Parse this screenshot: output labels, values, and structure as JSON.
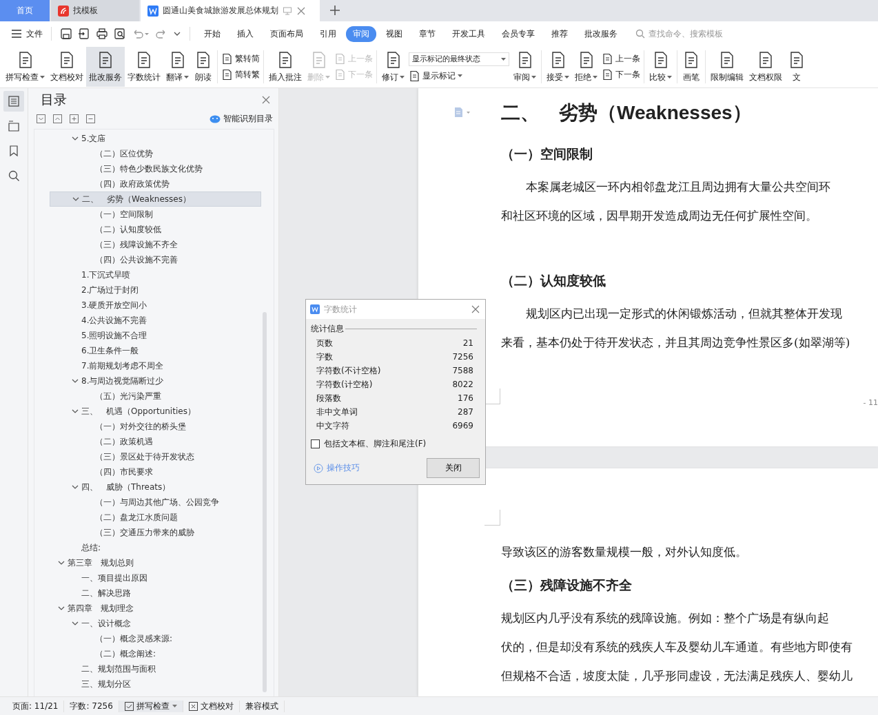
{
  "tabs": [
    {
      "kind": "home",
      "label": "首页",
      "selected": false
    },
    {
      "kind": "template",
      "label": "找模板",
      "selected": false
    },
    {
      "kind": "document",
      "label": "圆通山美食城旅游发展总体规划",
      "selected": true
    }
  ],
  "menu": {
    "file": "文件",
    "tabs": [
      {
        "label": "开始",
        "selected": false
      },
      {
        "label": "插入",
        "selected": false
      },
      {
        "label": "页面布局",
        "selected": false
      },
      {
        "label": "引用",
        "selected": false
      },
      {
        "label": "审阅",
        "selected": true
      },
      {
        "label": "视图",
        "selected": false
      },
      {
        "label": "章节",
        "selected": false
      },
      {
        "label": "开发工具",
        "selected": false
      },
      {
        "label": "会员专享",
        "selected": false
      },
      {
        "label": "推荐",
        "selected": false
      },
      {
        "label": "批改服务",
        "selected": false
      }
    ],
    "search": {
      "placeholder": "查找命令、搜索模板"
    }
  },
  "ribbon": [
    {
      "kind": "big",
      "label": "拼写检查",
      "dropdown": true,
      "disabled": false,
      "pressed": false
    },
    {
      "kind": "big",
      "label": "文档校对",
      "dropdown": false,
      "disabled": false,
      "pressed": false
    },
    {
      "kind": "big",
      "label": "批改服务",
      "dropdown": false,
      "disabled": false,
      "pressed": true
    },
    {
      "kind": "big",
      "label": "字数统计",
      "dropdown": false,
      "disabled": false,
      "pressed": false
    },
    {
      "kind": "big",
      "label": "翻译",
      "dropdown": true,
      "disabled": false,
      "pressed": false
    },
    {
      "kind": "big",
      "label": "朗读",
      "dropdown": false,
      "disabled": false,
      "pressed": false
    },
    {
      "kind": "separator"
    },
    {
      "kind": "stack",
      "items": [
        {
          "kind": "small",
          "label": "繁转简",
          "dropdown": false,
          "disabled": false
        },
        {
          "kind": "small",
          "label": "简转繁",
          "dropdown": false,
          "disabled": false
        }
      ]
    },
    {
      "kind": "separator"
    },
    {
      "kind": "big",
      "label": "插入批注",
      "dropdown": false,
      "disabled": false,
      "pressed": false
    },
    {
      "kind": "big",
      "label": "删除",
      "dropdown": true,
      "disabled": true,
      "pressed": false
    },
    {
      "kind": "stack",
      "items": [
        {
          "kind": "small",
          "label": "上一条",
          "dropdown": false,
          "disabled": true
        },
        {
          "kind": "small",
          "label": "下一条",
          "dropdown": false,
          "disabled": true
        }
      ]
    },
    {
      "kind": "separator"
    },
    {
      "kind": "big",
      "label": "修订",
      "dropdown": true,
      "disabled": false,
      "pressed": false
    },
    {
      "kind": "stack",
      "items": [
        {
          "kind": "select",
          "value": "显示标记的最终状态"
        },
        {
          "kind": "small",
          "label": "显示标记",
          "dropdown": true,
          "disabled": false
        }
      ]
    },
    {
      "kind": "big",
      "label": "审阅",
      "dropdown": true,
      "disabled": false,
      "pressed": false
    },
    {
      "kind": "separator"
    },
    {
      "kind": "big",
      "label": "接受",
      "dropdown": true,
      "disabled": false,
      "pressed": false
    },
    {
      "kind": "big",
      "label": "拒绝",
      "dropdown": true,
      "disabled": false,
      "pressed": false
    },
    {
      "kind": "stack",
      "items": [
        {
          "kind": "small",
          "label": "上一条",
          "dropdown": false,
          "disabled": false
        },
        {
          "kind": "small",
          "label": "下一条",
          "dropdown": false,
          "disabled": false
        }
      ]
    },
    {
      "kind": "separator"
    },
    {
      "kind": "big",
      "label": "比较",
      "dropdown": true,
      "disabled": false,
      "pressed": false
    },
    {
      "kind": "separator"
    },
    {
      "kind": "big",
      "label": "画笔",
      "dropdown": false,
      "disabled": false,
      "pressed": false
    },
    {
      "kind": "separator"
    },
    {
      "kind": "big",
      "label": "限制编辑",
      "dropdown": false,
      "disabled": false,
      "pressed": false
    },
    {
      "kind": "big",
      "label": "文档权限",
      "dropdown": false,
      "disabled": false,
      "pressed": false
    },
    {
      "kind": "big",
      "label": "文",
      "dropdown": false,
      "disabled": false,
      "pressed": false
    }
  ],
  "side_strip": [
    {
      "selected": true
    },
    {
      "selected": false
    },
    {
      "selected": false
    },
    {
      "selected": false
    }
  ],
  "toc": {
    "title": "目录",
    "smart_button": "智能识别目录",
    "leading_items": [
      {
        "label": "5.文庙",
        "expanded": true,
        "selected": false,
        "children": [
          {
            "label": "（二）区位优势",
            "selected": false
          },
          {
            "label": "（三）特色少数民族文化优势",
            "selected": false
          },
          {
            "label": "（四）政府政策优势",
            "selected": false
          }
        ]
      },
      {
        "label": "二、　劣势（Weaknesses）",
        "expanded": true,
        "selected": true,
        "children": [
          {
            "label": "（一）空间限制",
            "selected": false
          },
          {
            "label": "（二）认知度较低",
            "selected": false
          },
          {
            "label": "（三）残障设施不齐全",
            "selected": false
          },
          {
            "label": "（四）公共设施不完善",
            "selected": false
          }
        ]
      },
      {
        "label": "1.下沉式旱喷",
        "selected": false
      },
      {
        "label": "2.广场过于封闭",
        "selected": false
      },
      {
        "label": "3.硬质开放空间小",
        "selected": false
      },
      {
        "label": "4.公共设施不完善",
        "selected": false
      },
      {
        "label": "5.照明设施不合理",
        "selected": false
      },
      {
        "label": "6.卫生条件一般",
        "selected": false
      },
      {
        "label": "7.前期规划考虑不周全",
        "selected": false
      },
      {
        "label": "8.与周边视觉隔断过少",
        "expanded": true,
        "selected": false,
        "children": [
          {
            "label": "（五）光污染严重",
            "selected": false
          }
        ]
      },
      {
        "label": "三、　机遇（Opportunities）",
        "expanded": true,
        "selected": false,
        "children": [
          {
            "label": "（一）对外交往的桥头堡",
            "selected": false
          },
          {
            "label": "（二）政策机遇",
            "selected": false
          },
          {
            "label": "（三）景区处于待开发状态",
            "selected": false
          },
          {
            "label": "（四）市民要求",
            "selected": false
          }
        ]
      },
      {
        "label": "四、　威胁（Threats）",
        "expanded": true,
        "selected": false,
        "children": [
          {
            "label": "（一）与周边其他广场、公园竞争",
            "selected": false
          },
          {
            "label": "（二）盘龙江水质问题",
            "selected": false
          },
          {
            "label": "（三）交通压力带来的威胁",
            "selected": false
          }
        ]
      },
      {
        "label": "总结:",
        "selected": false
      }
    ],
    "chapters": [
      {
        "label": "第三章　规划总则",
        "expanded": true,
        "selected": false,
        "children": [
          {
            "label": "一、项目提出原因",
            "selected": false
          },
          {
            "label": "二、解决思路",
            "selected": false
          }
        ]
      },
      {
        "label": "第四章　规划理念",
        "expanded": true,
        "selected": false,
        "children": [
          {
            "label": "一、设计概念",
            "expanded": true,
            "selected": false,
            "children": [
              {
                "label": "（一）概念灵感来源:",
                "selected": false
              },
              {
                "label": "（二）概念阐述:",
                "selected": false
              }
            ]
          },
          {
            "label": "二、规划范围与面积",
            "selected": false
          },
          {
            "label": "三、规划分区",
            "selected": false
          }
        ]
      }
    ]
  },
  "document": {
    "pages": [
      {
        "blocks": [
          {
            "kind": "heading",
            "text": "二、　劣势（Weaknesses）"
          },
          {
            "kind": "subheading",
            "text": "（一）空间限制"
          },
          {
            "kind": "paragraph",
            "indent": true,
            "text": "本案属老城区一环内相邻盘龙江且周边拥有大量公共空间环"
          },
          {
            "kind": "paragraph",
            "indent": false,
            "text": "和社区环境的区域，因早期开发造成周边无任何扩展性空间。"
          },
          {
            "kind": "spacer"
          },
          {
            "kind": "subheading",
            "text": "（二）认知度较低"
          },
          {
            "kind": "paragraph",
            "indent": true,
            "text": "规划区内已出现一定形式的休闲锻炼活动，但就其整体开发现"
          },
          {
            "kind": "paragraph",
            "indent": false,
            "text": "来看，基本仍处于待开发状态，并且其周边竞争性景区多(如翠湖等)"
          }
        ],
        "page_number": "- 11"
      },
      {
        "blocks": [
          {
            "kind": "paragraph",
            "indent": false,
            "text": "导致该区的游客数量规模一般，对外认知度低。"
          },
          {
            "kind": "subheading",
            "text": "（三）残障设施不齐全"
          },
          {
            "kind": "paragraph",
            "indent": false,
            "text": "规划区内几乎没有系统的残障设施。例如：整个广场是有纵向起"
          },
          {
            "kind": "paragraph",
            "indent": false,
            "text": "伏的，但是却没有系统的残疾人车及婴幼儿车通道。有些地方即使有"
          },
          {
            "kind": "paragraph",
            "indent": false,
            "text": "但规格不合适，坡度太陡，几乎形同虚设，无法满足残疾人、婴幼儿"
          }
        ]
      }
    ]
  },
  "dialog": {
    "title": "字数统计",
    "group": "统计信息",
    "rows": [
      {
        "label": "页数",
        "value": "21"
      },
      {
        "label": "字数",
        "value": "7256"
      },
      {
        "label": "字符数(不计空格)",
        "value": "7588"
      },
      {
        "label": "字符数(计空格)",
        "value": "8022"
      },
      {
        "label": "段落数",
        "value": "176"
      },
      {
        "label": "非中文单词",
        "value": "287"
      },
      {
        "label": "中文字符",
        "value": "6969"
      }
    ],
    "checkbox": {
      "label": "包括文本框、脚注和尾注(F)",
      "checked": false
    },
    "tips_link": "操作技巧",
    "close_button": "关闭"
  },
  "status_bar": {
    "page": "页面: 11/21",
    "words": "字数: 7256",
    "spell_check": "拼写检查",
    "proofread": "文档校对",
    "mode": "兼容模式"
  }
}
